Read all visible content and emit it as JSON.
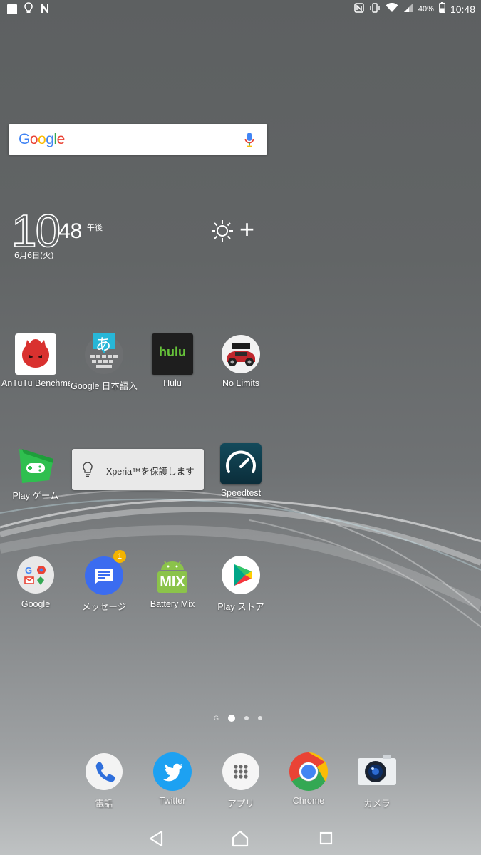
{
  "status_bar": {
    "time": "10:48",
    "battery_percent": "40%",
    "left_icons": [
      "notification-square-icon",
      "lightbulb-icon",
      "n-icon"
    ],
    "right_icons": [
      "nfc-icon",
      "vibrate-icon",
      "wifi-icon",
      "signal-icon",
      "battery-icon"
    ]
  },
  "search": {
    "logo": "Google",
    "icon": "mic-icon"
  },
  "clock": {
    "hour": "10",
    "minute": "48",
    "ampm": "午後",
    "date": "6月6日(火)"
  },
  "weather": {
    "icon": "sun-icon",
    "add_icon": "plus-icon"
  },
  "apps_row1": [
    {
      "label": "AnTuTu Benchma",
      "icon": "antutu-icon"
    },
    {
      "label": "Google 日本語入",
      "icon": "japanese-keyboard-icon"
    },
    {
      "label": "Hulu",
      "icon": "hulu-icon",
      "icon_text": "hulu"
    },
    {
      "label": "No Limits",
      "icon": "need-for-speed-icon"
    }
  ],
  "apps_row2": [
    {
      "label": "Play ゲーム",
      "icon": "play-games-icon"
    },
    {
      "label": "Speedtest",
      "icon": "speedtest-icon"
    }
  ],
  "toast": {
    "text": "Xperia™を保護します",
    "icon": "lightbulb-icon"
  },
  "apps_row3": [
    {
      "label": "Google",
      "icon": "google-folder-icon"
    },
    {
      "label": "メッセージ",
      "icon": "messages-icon",
      "badge": "1"
    },
    {
      "label": "Battery Mix",
      "icon": "battery-mix-icon",
      "icon_text": "MIX"
    },
    {
      "label": "Play ストア",
      "icon": "play-store-icon"
    }
  ],
  "hiragana": "あ",
  "pager": {
    "g_label": "G",
    "pages": 3,
    "active_index": 0
  },
  "dock": [
    {
      "label": "電話",
      "icon": "phone-icon"
    },
    {
      "label": "Twitter",
      "icon": "twitter-icon"
    },
    {
      "label": "アプリ",
      "icon": "app-drawer-icon"
    },
    {
      "label": "Chrome",
      "icon": "chrome-icon"
    },
    {
      "label": "カメラ",
      "icon": "camera-icon"
    }
  ],
  "nav": [
    "back-icon",
    "home-icon",
    "recents-icon"
  ],
  "colors": {
    "antutu_red": "#d9312f",
    "hulu_green": "#66c23a",
    "twitter_blue": "#1da1f2",
    "messages_blue": "#3b6cf0",
    "badge_yellow": "#f4b400",
    "play_games_green": "#2fbf4f",
    "battery_mix_green": "#8bc34a",
    "speedtest_teal": "#0e3b4a"
  }
}
